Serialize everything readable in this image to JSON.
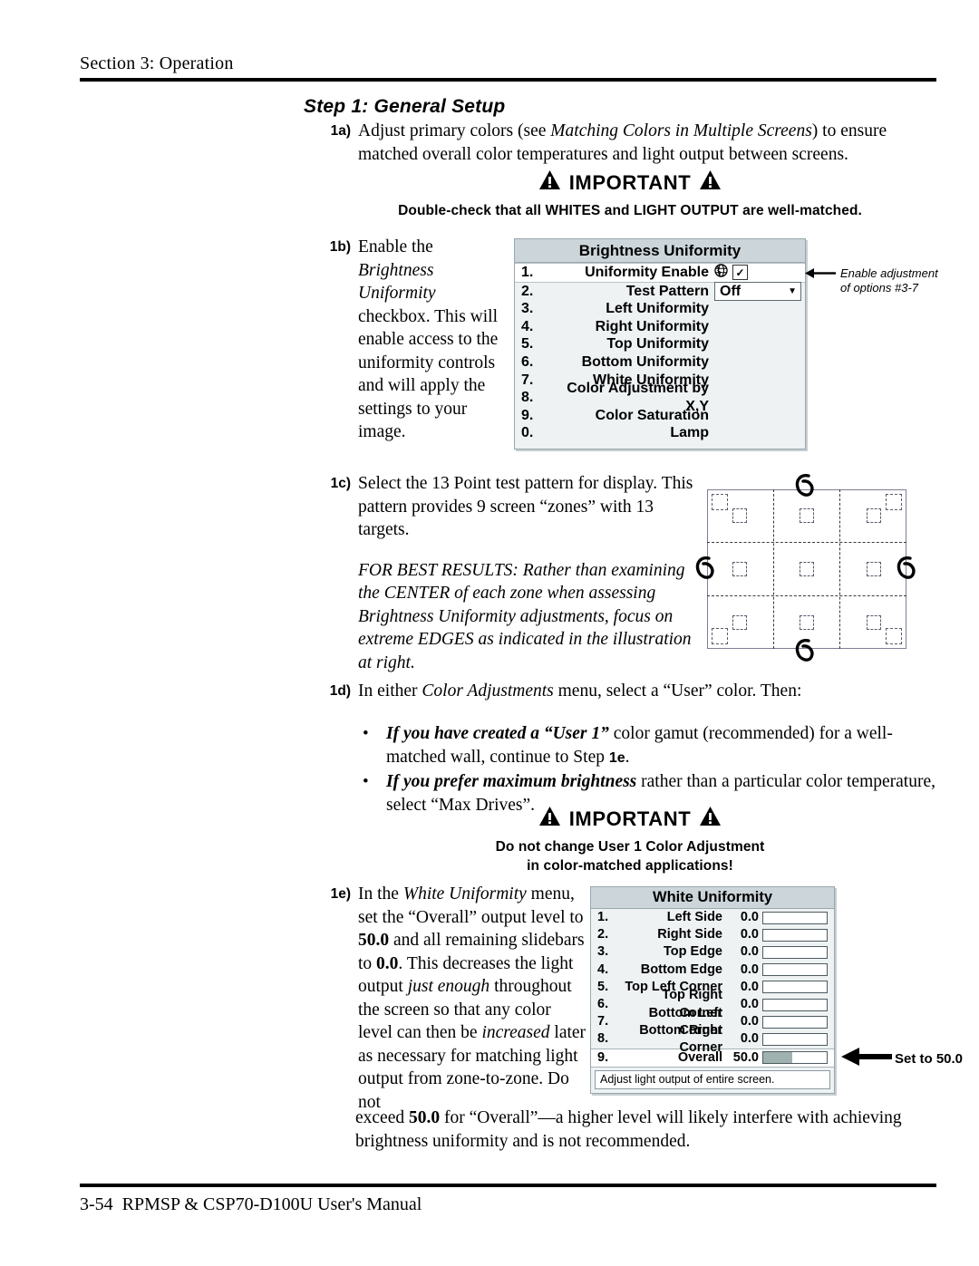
{
  "header": {
    "section_title": "Section 3: Operation"
  },
  "footer": {
    "page_number": "3-54",
    "manual_title": "RPMSP & CSP70-D100U User's Manual"
  },
  "step_heading": "Step 1: General Setup",
  "steps": {
    "s1a": {
      "label": "1a)",
      "text_1": "Adjust primary colors (see ",
      "text_italic": "Matching Colors in Multiple Screens",
      "text_2": ") to ensure matched overall color temperatures and light output between screens."
    },
    "s1b": {
      "label": "1b)",
      "text_1": "Enable the ",
      "text_italic": "Brightness Uniformity",
      "text_2": " checkbox. This will enable access to the uniformity controls and will apply the settings to your image."
    },
    "s1c": {
      "label": "1c)",
      "text_1": "Select the 13 Point test pattern for display. This pattern provides 9 screen “zones” with 13 targets.",
      "text_italic": "FOR BEST RESULTS: Rather than examining the CENTER of each zone when assessing Brightness Uniformity adjustments, focus on extreme EDGES as indicated in the illustration at right."
    },
    "s1d": {
      "label": "1d)",
      "text_1": "In either ",
      "text_italic": "Color Adjustments",
      "text_2": " menu, select a “User” color. Then:",
      "bullets": [
        {
          "bold_italic": "If you have created a “User 1”",
          "rest_1": " color gamut (recommended) for a well-matched wall, continue to Step ",
          "bold_sans": "1e",
          "rest_2": "."
        },
        {
          "bold_italic": "If you prefer maximum brightness",
          "rest_1": " rather than a particular color temperature, select “Max Drives”.",
          "bold_sans": "",
          "rest_2": ""
        }
      ]
    },
    "s1e": {
      "label": "1e)",
      "text_1": "In the ",
      "text_italic": "White Uniformity",
      "text_2": " menu, set the “Overall” output level to ",
      "bold_1": "50.0",
      "text_3": " and all remaining slidebars to ",
      "bold_2": "0.0",
      "text_4": ". This decreases the light output ",
      "italic_2": "just enough",
      "text_5": " throughout the screen so that any color level can then be ",
      "italic_3": "increased",
      "text_6": " later as necessary for matching light output from zone-to-zone. Do not",
      "tail_1": "exceed ",
      "tail_bold": "50.0",
      "tail_2": " for “Overall”—a higher level will likely interfere with achieving brightness uniformity and is not recommended."
    }
  },
  "important_blocks": [
    {
      "heading": "IMPORTANT",
      "note": "Double-check that all WHITES and LIGHT OUTPUT are well-matched."
    },
    {
      "heading": "IMPORTANT",
      "note_line_1": "Do not change User 1 Color Adjustment",
      "note_line_2": "in color-matched applications!"
    }
  ],
  "menus": {
    "brightness_uniformity": {
      "title": "Brightness Uniformity",
      "rows": [
        {
          "num": "1.",
          "name": "Uniformity Enable",
          "control": "checkbox",
          "checked": "✓"
        },
        {
          "num": "2.",
          "name": "Test Pattern",
          "control": "dropdown",
          "value": "Off",
          "caret": "▼"
        },
        {
          "num": "3.",
          "name": "Left Uniformity",
          "control": "none"
        },
        {
          "num": "4.",
          "name": "Right Uniformity",
          "control": "none"
        },
        {
          "num": "5.",
          "name": "Top Uniformity",
          "control": "none"
        },
        {
          "num": "6.",
          "name": "Bottom Uniformity",
          "control": "none"
        },
        {
          "num": "7.",
          "name": "White Uniformity",
          "control": "none"
        },
        {
          "num": "8.",
          "name": "Color Adjustment by X,Y",
          "control": "none"
        },
        {
          "num": "9.",
          "name": "Color Saturation",
          "control": "none"
        },
        {
          "num": "0.",
          "name": "Lamp",
          "control": "none"
        }
      ]
    },
    "white_uniformity": {
      "title": "White Uniformity",
      "rows": [
        {
          "num": "1.",
          "name": "Left Side",
          "value": "0.0",
          "fill_pct": 0
        },
        {
          "num": "2.",
          "name": "Right Side",
          "value": "0.0",
          "fill_pct": 0
        },
        {
          "num": "3.",
          "name": "Top Edge",
          "value": "0.0",
          "fill_pct": 0
        },
        {
          "num": "4.",
          "name": "Bottom Edge",
          "value": "0.0",
          "fill_pct": 0
        },
        {
          "num": "5.",
          "name": "Top Left Corner",
          "value": "0.0",
          "fill_pct": 0
        },
        {
          "num": "6.",
          "name": "Top Right Corner",
          "value": "0.0",
          "fill_pct": 0
        },
        {
          "num": "7.",
          "name": "Bottom Left Corner",
          "value": "0.0",
          "fill_pct": 0
        },
        {
          "num": "8.",
          "name": "Bottom Right Corner",
          "value": "0.0",
          "fill_pct": 0
        },
        {
          "num": "9.",
          "name": "Overall",
          "value": "50.0",
          "fill_pct": 45
        }
      ],
      "hint": "Adjust light output of entire screen."
    }
  },
  "annotations": {
    "enable_adjustment": "Enable adjustment\nof options #3-7",
    "set_to_50": "Set to 50.0"
  },
  "test_pattern": {
    "zones": 9,
    "targets": 13,
    "edge_marks": 4
  },
  "colors": {
    "menu_title_bg": "#ccd6da",
    "menu_body_bg": "#eef2f3",
    "menu_border": "#9aa7ad",
    "slider_fill": "#9fb2b0",
    "text": "#000000"
  }
}
